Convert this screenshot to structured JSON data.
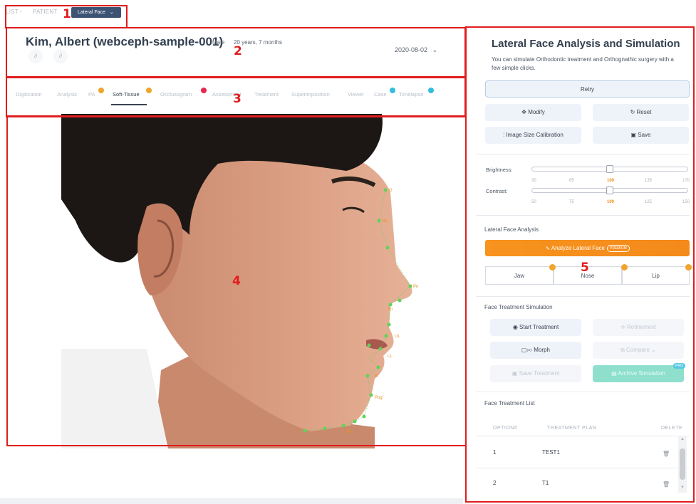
{
  "breadcrumb": {
    "list": "LIST",
    "patient": "PATIENT",
    "current": "Lateral Face"
  },
  "annotations": [
    "1",
    "2",
    "3",
    "4",
    "5"
  ],
  "patient": {
    "name": "Kim, Albert (webceph-sample-001)",
    "gender": "Male",
    "age": "20 years, 7 months",
    "date": "2020-08-02"
  },
  "tabs": [
    {
      "label": "Digitization"
    },
    {
      "label": "Analysis"
    },
    {
      "label": "PA"
    },
    {
      "label": "Soft-Tissue"
    },
    {
      "label": "Occlusogram"
    },
    {
      "label": "Assessment"
    },
    {
      "label": "Treatment"
    },
    {
      "label": "Superimposition"
    },
    {
      "label": "Viewer"
    },
    {
      "label": "Case"
    },
    {
      "label": "Timelapse"
    }
  ],
  "landmarks": [
    "G",
    "Na'",
    "Pn",
    "Sn",
    "UL",
    "LL",
    "B'",
    "Pog'",
    "Me'"
  ],
  "panel": {
    "title": "Lateral Face Analysis and Simulation",
    "description": "You can simulate Orthodontic treatment and Orthognathic surgery with a few simple clicks.",
    "retry": "Retry",
    "modify": "Modify",
    "reset": "Reset",
    "calibration": "Image Size Calibration",
    "save": "Save",
    "brightness": {
      "label": "Brightness:",
      "ticks": [
        "30",
        "65",
        "100",
        "135",
        "170"
      ],
      "value": 100
    },
    "contrast": {
      "label": "Contrast:",
      "ticks": [
        "50",
        "75",
        "100",
        "125",
        "150"
      ],
      "value": 100
    },
    "lateral_section": "Lateral Face Analysis",
    "analyze": "Analyze Lateral Face",
    "premium": "PREMIUM",
    "segments": [
      "Jaw",
      "Nose",
      "Lip"
    ],
    "sim_section": "Face Treatment Simulation",
    "start_treatment": "Start Treatment",
    "refinement": "Refinement",
    "morph": "Morph",
    "compare": "Compare",
    "save_treatment": "Save Treatment",
    "archive": "Archive Simulation",
    "pro": "PRO",
    "list_section": "Face Treatment List",
    "table": {
      "headers": [
        "OPTION#",
        "TREATMENT PLAN",
        "DELETE"
      ],
      "rows": [
        {
          "option": "1",
          "plan": "TEST1"
        },
        {
          "option": "2",
          "plan": "T1"
        }
      ]
    }
  },
  "colors": {
    "accent": "#3d5374",
    "orange": "#f7931e",
    "teal": "#7ed9c4",
    "landmark": "#5fd35a",
    "annotation": "#e11d1d"
  }
}
